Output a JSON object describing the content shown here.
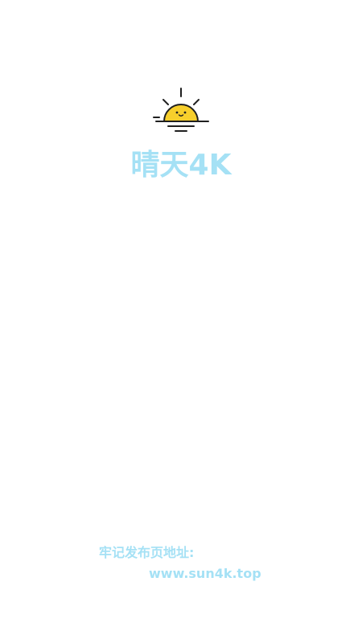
{
  "app": {
    "name": "晴天4K"
  },
  "notice": {
    "label": "牢记发布页地址:",
    "url": "www.sun4k.top"
  },
  "icons": {
    "logo": "sunrise-icon"
  },
  "colors": {
    "background": "#ffffff",
    "accent": "#a5e1f5",
    "sun": "#f7cf2c",
    "outline": "#1f1f1f"
  }
}
